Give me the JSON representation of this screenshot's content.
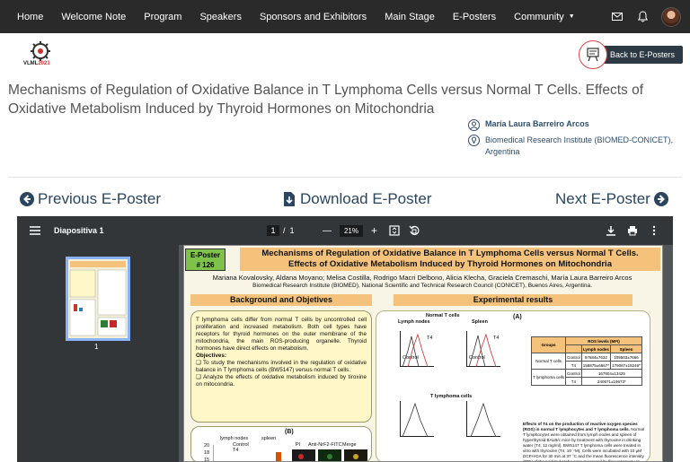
{
  "nav": {
    "items": [
      "Home",
      "Welcome Note",
      "Program",
      "Speakers",
      "Sponsors and Exhibitors",
      "Main Stage",
      "E-Posters",
      "Community"
    ]
  },
  "logo": {
    "prefix": "VLML",
    "year": "2021"
  },
  "back_button": "Back to E-Posters",
  "poster_title": "Mechanisms of Regulation of Oxidative Balance in T Lymphoma Cells versus Normal T Cells. Effects of Oxidative Metabolism Induced by Thyroid Hormones on Mitochondria",
  "author": {
    "name": "María Laura Barreiro Arcos",
    "institution": "Biomedical Research Institute (BIOMED-CONICET), Argentina"
  },
  "poster_nav": {
    "previous": "Previous E-Poster",
    "download": "Download E-Poster",
    "next": "Next E-Poster"
  },
  "viewer": {
    "file_name": "Diapositiva 1",
    "current_page": "1",
    "page_sep": "/",
    "total_pages": "1",
    "zoom": "21%",
    "thumb_label": "1"
  },
  "poster": {
    "badge_line1": "E-Poster",
    "badge_line2": "# 126",
    "title_line1": "Mechanisms of Regulation of Oxidative Balance in T Lymphoma Cells versus Normal T Cells.",
    "title_line2": "Effects of Oxidative Metabolism Induced by Thyroid Hormones on Mitochondria",
    "authors": "Mariana Kovalovsky, Aldana Moyano; Melisa Costilla, Rodrigo Macri Delbono, Alicia Klecha, Graciela Cremaschi, María Laura Barreiro Arcos",
    "affiliation": "Biomedical Research Institute (BIOMED), National Scientific and Technical Research Council (CONICET), Buenos Aires, Argentina.",
    "bg_heading": "Background and Objetives",
    "res_heading": "Experimental results",
    "bg_text": "T lymphoma cells differ from normal T cells by uncontrolled cell proliferation and increased metabolism. Both cell types have receptors for thyroid hormones on the outer membrane of the mitochondria, the main ROS-producing organelle. Thyroid hormones have direct effects on metabolism.",
    "objectives": "Objectives:",
    "obj1": "❑ To study the mechanisms involved in the regulation of oxidative balance in T lymphoma cells (BW5147) versus normal T cells.",
    "obj2": "❑ Analyze the effects of oxidative metabolism induced by tiroxine on mitocondria.",
    "panel_a": "(A)",
    "panel_b": "(B)",
    "normal_t": "Normal T cells",
    "lymph": "Lymph nodes",
    "spleen": "Spleen",
    "t_lymphoma": "T lymphoma cells",
    "control": "Control",
    "t4": "T4",
    "tbl_groups": "Groups",
    "tbl_ros": "ROS levels (MFI)",
    "tbl_ln": "Lymph nodes",
    "tbl_sp": "Spleen",
    "tbl_normal": "Normal T cells",
    "tbl_lymphoma": "T lymphoma cells",
    "tbl_r1": [
      "97684±7632",
      "109503±7666"
    ],
    "tbl_r2": [
      "158875±6667*",
      "179087±18246*"
    ],
    "tbl_r3": [
      "167804±13425",
      ""
    ],
    "tbl_r4": [
      "240671±19673*",
      ""
    ],
    "res_text_title": "Effects of T4 on the production of reactive oxygen species (ROS) in normal T lymphocytes and T lymphoma cells.",
    "res_text": "Normal T lymphocytes were obtained from lymph nodes and spleen of hyperthyroid BALB/c mice by treatment with thyroxine in drinking water (T4; 12 mg/ml). BW5147 T lymphoma cells were treated in vitro with thyroxine (T4, 10⁻⁷M). Cells were incubated with 10 µM DCFH-DA for 30 min at 37 °C and the mean fluorescence intensity (MFI) of the oxidized probe were measured by flow cytometry at 488 nm. Representative histograms of n=10 independent assays are shown. The table shows the MFI ± SE (*p <0.01).",
    "b_lymph": "lymph nodes",
    "b_spleen": "spleen",
    "b_pi": "PI",
    "b_anti": "Anti-NrF2-FITC",
    "b_merge": "Merge",
    "b_ticks": [
      "20",
      "18",
      "15"
    ]
  }
}
